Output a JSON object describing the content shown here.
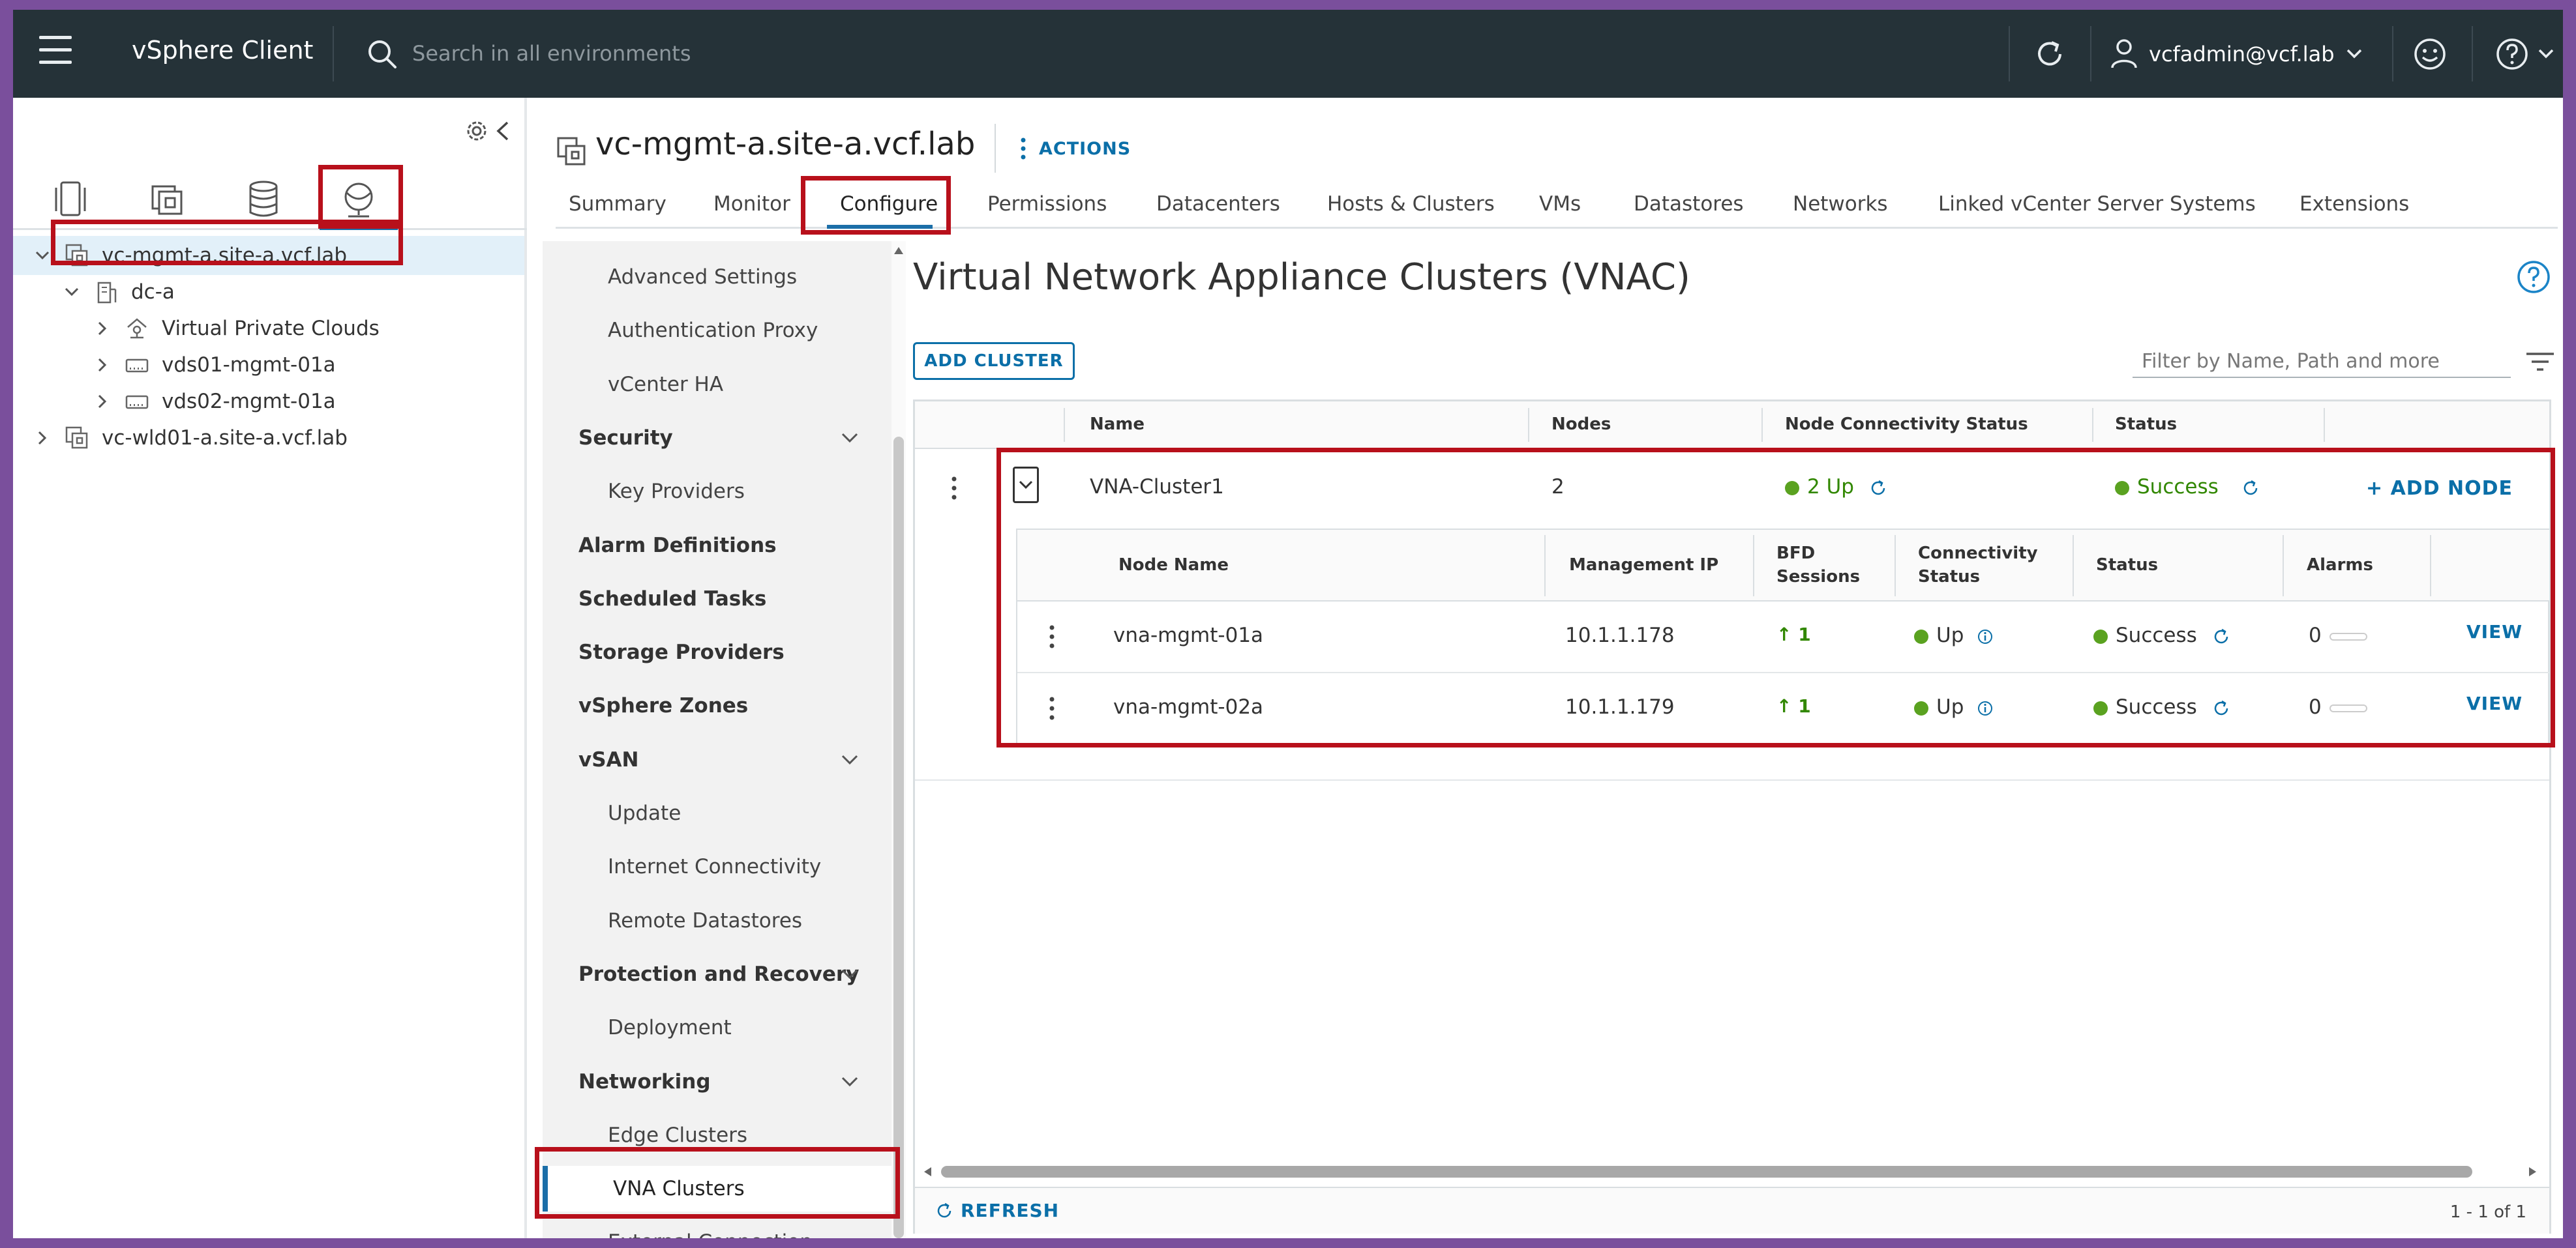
{
  "header": {
    "app_title": "vSphere Client",
    "search_placeholder": "Search in all environments",
    "user": "vcfadmin@vcf.lab",
    "icons": [
      "menu-icon",
      "search-icon",
      "refresh-icon",
      "user-icon",
      "chevron-down-icon",
      "smiley-icon",
      "help-icon"
    ]
  },
  "inventory_tabs": [
    "hosts-and-clusters-icon",
    "vms-and-templates-icon",
    "storage-icon",
    "networking-icon"
  ],
  "tree": [
    {
      "label": "vc-mgmt-a.site-a.vcf.lab",
      "selected": true
    },
    {
      "label": "dc-a"
    },
    {
      "label": "Virtual Private Clouds"
    },
    {
      "label": "vds01-mgmt-01a"
    },
    {
      "label": "vds02-mgmt-01a"
    },
    {
      "label": "vc-wld01-a.site-a.vcf.lab"
    }
  ],
  "object": {
    "title": "vc-mgmt-a.site-a.vcf.lab",
    "actions_label": "ACTIONS"
  },
  "tabs": [
    "Summary",
    "Monitor",
    "Configure",
    "Permissions",
    "Datacenters",
    "Hosts & Clusters",
    "VMs",
    "Datastores",
    "Networks",
    "Linked vCenter Server Systems",
    "Extensions"
  ],
  "active_tab": "Configure",
  "config_menu": [
    {
      "label": "Advanced Settings",
      "kind": "child"
    },
    {
      "label": "Authentication Proxy",
      "kind": "child"
    },
    {
      "label": "vCenter HA",
      "kind": "child"
    },
    {
      "label": "Security",
      "kind": "group"
    },
    {
      "label": "Key Providers",
      "kind": "child"
    },
    {
      "label": "Alarm Definitions",
      "kind": "group"
    },
    {
      "label": "Scheduled Tasks",
      "kind": "group"
    },
    {
      "label": "Storage Providers",
      "kind": "group"
    },
    {
      "label": "vSphere Zones",
      "kind": "group"
    },
    {
      "label": "vSAN",
      "kind": "group"
    },
    {
      "label": "Update",
      "kind": "child"
    },
    {
      "label": "Internet Connectivity",
      "kind": "child"
    },
    {
      "label": "Remote Datastores",
      "kind": "child"
    },
    {
      "label": "Protection and Recovery",
      "kind": "group"
    },
    {
      "label": "Deployment",
      "kind": "child"
    },
    {
      "label": "Networking",
      "kind": "group"
    },
    {
      "label": "Edge Clusters",
      "kind": "child"
    },
    {
      "label": "VNA Clusters",
      "kind": "child",
      "selected": true
    },
    {
      "label": "External Connection",
      "kind": "child"
    }
  ],
  "content": {
    "title": "Virtual Network Appliance Clusters (VNAC)",
    "add_cluster_label": "ADD CLUSTER",
    "filter_placeholder": "Filter by Name, Path and more",
    "columns": [
      "Name",
      "Nodes",
      "Node Connectivity Status",
      "Status"
    ],
    "cluster": {
      "name": "VNA-Cluster1",
      "nodes": "2",
      "connectivity": "2 Up",
      "status": "Success",
      "add_node_label": "+ ADD NODE"
    },
    "node_columns": {
      "node_name": "Node Name",
      "mgmt_ip": "Management IP",
      "bfd_1": "BFD",
      "bfd_2": "Sessions",
      "conn_1": "Connectivity",
      "conn_2": "Status",
      "status": "Status",
      "alarms": "Alarms"
    },
    "nodes": [
      {
        "name": "vna-mgmt-01a",
        "ip": "10.1.1.178",
        "bfd": "1",
        "connectivity": "Up",
        "status": "Success",
        "alarms": "0",
        "view": "VIEW"
      },
      {
        "name": "vna-mgmt-02a",
        "ip": "10.1.1.179",
        "bfd": "1",
        "connectivity": "Up",
        "status": "Success",
        "alarms": "0",
        "view": "VIEW"
      }
    ],
    "refresh_label": "REFRESH",
    "page_count": "1 - 1 of 1"
  },
  "colors": {
    "accent": "#1b6ea8",
    "header_bg": "#253238",
    "success": "#5aa220",
    "highlight": "#b8101b",
    "frame": "#7a4f9c"
  }
}
